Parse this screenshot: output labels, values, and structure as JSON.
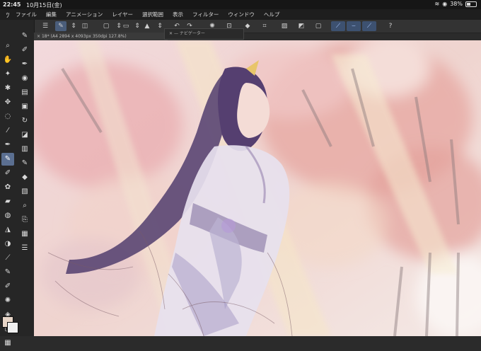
{
  "status_bar": {
    "time": "22:45",
    "date": "10月15日(金)",
    "battery": "38%",
    "battery_level": 0.38
  },
  "menu": {
    "items": [
      "ファイル",
      "編集",
      "アニメーション",
      "レイヤー",
      "選択範囲",
      "表示",
      "フィルター",
      "ウィンドウ",
      "ヘルプ"
    ]
  },
  "document_tab": {
    "title": "18* (A4 2894 x 4093px 350dpi 127.8%)"
  },
  "navigator_popup": {
    "label": "ナビゲーター"
  },
  "toolbar": {
    "icons": [
      "menu-icon",
      "quick-access-icon",
      "sub-view-icon",
      "new-file-icon",
      "open-file-icon",
      "save-icon",
      "undo-icon",
      "redo-icon",
      "settings-icon",
      "transform-icon",
      "fill-icon",
      "select-icon",
      "snap-icon",
      "ruler-icon",
      "stroke-1-icon",
      "stroke-2-icon",
      "stroke-3-icon",
      "help-icon"
    ]
  },
  "left_tools": {
    "icons": [
      "zoom-icon",
      "hand-icon",
      "magic-wand-icon",
      "move-icon",
      "lasso-icon",
      "eyedropper-icon",
      "pen-icon",
      "brush-icon",
      "eraser-icon",
      "fill-bucket-icon",
      "gradient-icon",
      "text-icon",
      "figure-icon",
      "palette-icon"
    ]
  },
  "colors": {
    "main": "#e8d6c8",
    "sub": "#f0f0f0",
    "accent": "#5b6f91"
  }
}
